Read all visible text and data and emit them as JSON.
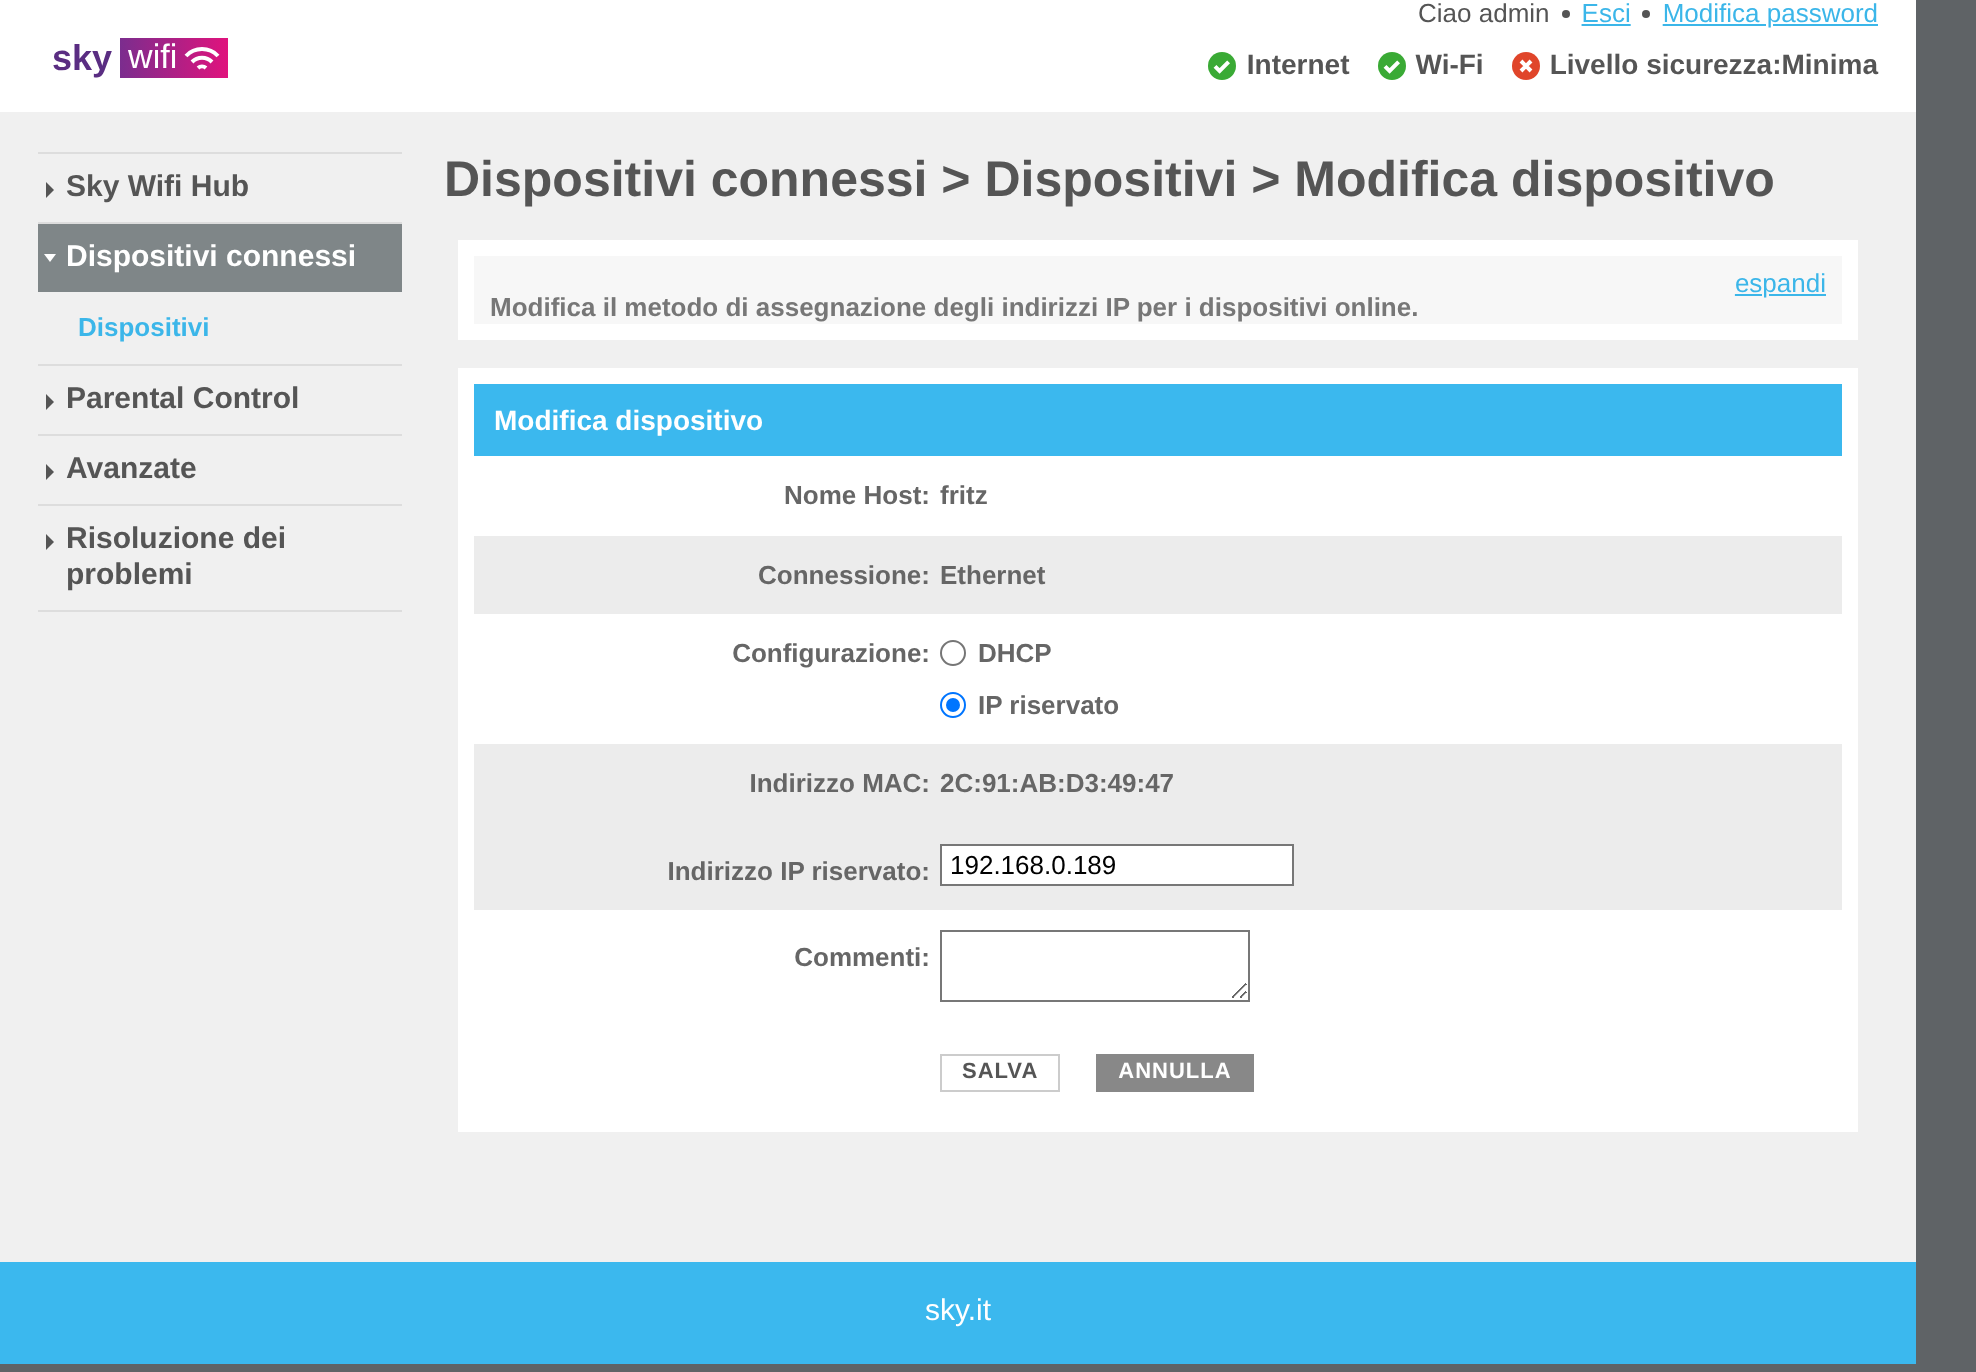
{
  "logo": {
    "brand": "sky",
    "product": "wifi"
  },
  "user_links": [
    {
      "kind": "text",
      "label": "Ciao admin"
    },
    {
      "kind": "link",
      "label": "Esci"
    },
    {
      "kind": "link",
      "label": "Modifica password"
    }
  ],
  "status": [
    {
      "label": "Internet",
      "kind": "ok"
    },
    {
      "label": "Wi-Fi",
      "kind": "ok"
    },
    {
      "label": "Livello sicurezza:Minima",
      "kind": "error"
    }
  ],
  "sidebar": {
    "items": [
      {
        "label": "Sky Wifi Hub",
        "expanded": false,
        "selected": false
      },
      {
        "label": "Dispositivi connessi",
        "expanded": true,
        "selected": true,
        "children": [
          {
            "label": "Dispositivi"
          }
        ]
      },
      {
        "label": "Parental Control",
        "expanded": false,
        "selected": false
      },
      {
        "label": "Avanzate",
        "expanded": false,
        "selected": false
      },
      {
        "label": "Risoluzione dei problemi",
        "expanded": false,
        "selected": false
      }
    ]
  },
  "breadcrumb": "Dispositivi connessi > Dispositivi > Modifica dispositivo",
  "info": {
    "text": "Modifica il metodo di assegnazione degli indirizzi IP per i dispositivi online.",
    "link": "espandi"
  },
  "form": {
    "title": "Modifica dispositivo",
    "rows": [
      {
        "kind": "text",
        "label": "Nome Host:",
        "value": "fritz",
        "shaded": false
      },
      {
        "kind": "text",
        "label": "Connessione:",
        "value": "Ethernet",
        "shaded": true
      },
      {
        "kind": "radio",
        "label": "Configurazione:",
        "options": [
          {
            "label": "DHCP",
            "selected": false
          },
          {
            "label": "IP riservato",
            "selected": true
          }
        ],
        "shaded": false
      },
      {
        "kind": "text",
        "label": "Indirizzo MAC:",
        "value": "2C:91:AB:D3:49:47",
        "shaded": true
      },
      {
        "kind": "input",
        "label": "Indirizzo IP riservato:",
        "value": "192.168.0.189",
        "shaded": true
      },
      {
        "kind": "textarea",
        "label": "Commenti:",
        "shaded": false
      }
    ],
    "buttons": [
      {
        "label": "SALVA",
        "kind": "secondary"
      },
      {
        "label": "ANNULLA",
        "kind": "primary"
      }
    ]
  },
  "footer": "sky.it"
}
